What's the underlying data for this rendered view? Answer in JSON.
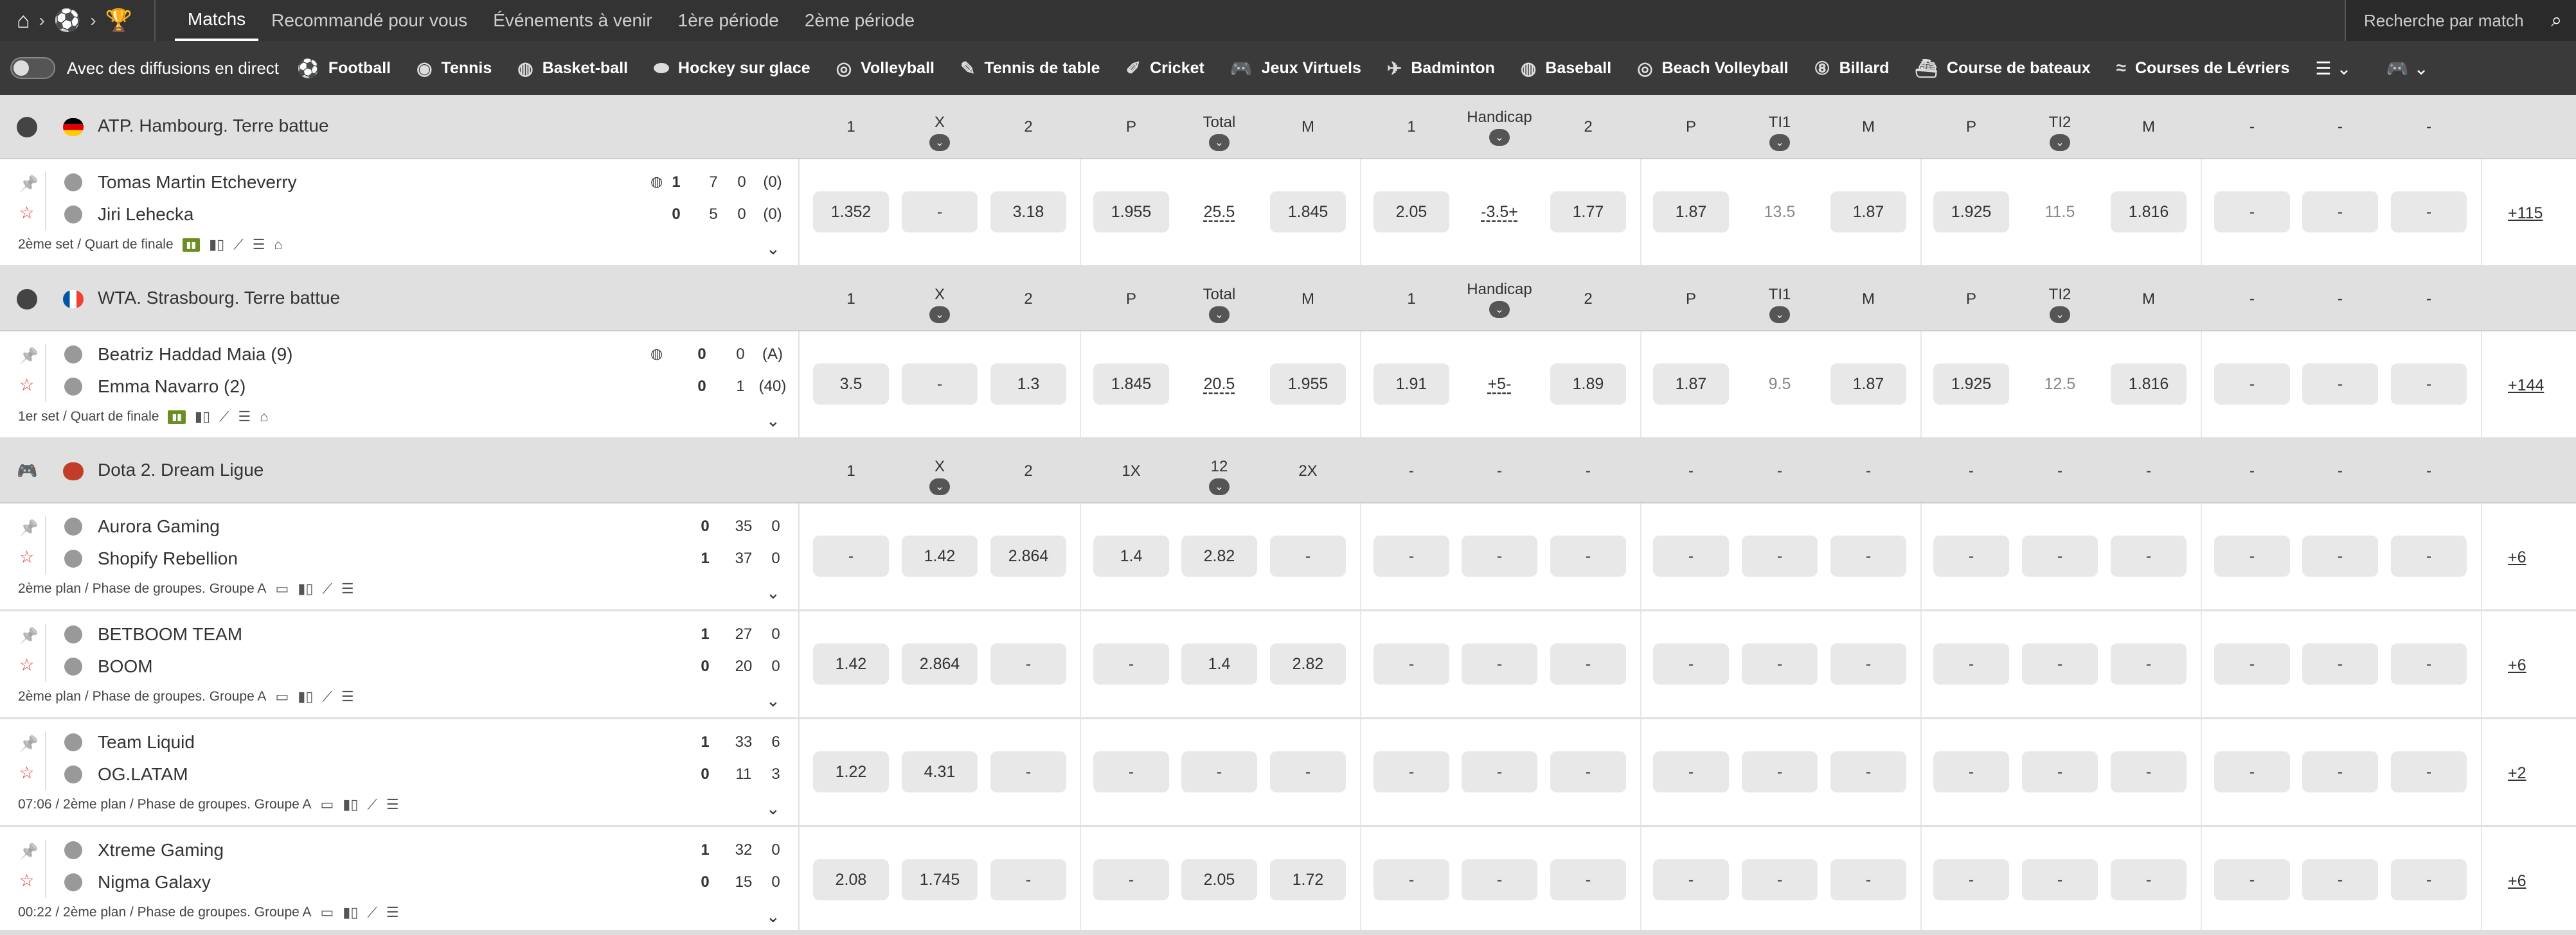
{
  "nav": {
    "home_icon": "home-icon",
    "tabs": [
      {
        "label": "Matchs",
        "active": true
      },
      {
        "label": "Recommandé pour vous"
      },
      {
        "label": "Événements à venir"
      },
      {
        "label": "1ère période"
      },
      {
        "label": "2ème période"
      }
    ],
    "search_placeholder": "Recherche par match"
  },
  "sports_bar": {
    "live_label": "Avec des diffusions en direct",
    "sports": [
      "Football",
      "Tennis",
      "Basket-ball",
      "Hockey sur glace",
      "Volleyball",
      "Tennis de table",
      "Cricket",
      "Jeux Virtuels",
      "Badminton",
      "Baseball",
      "Beach Volleyball",
      "Billard",
      "Course de bateaux",
      "Courses de Lévriers"
    ]
  },
  "leagues": [
    {
      "name": "ATP. Hambourg. Terre battue",
      "flag": "germany",
      "sport_icon": "tennis-ball-icon",
      "headers": [
        "1",
        "X",
        "2",
        "P",
        "Total",
        "M",
        "1",
        "Handicap",
        "2",
        "P",
        "TI1",
        "M",
        "P",
        "TI2",
        "M",
        "-",
        "-",
        "-"
      ],
      "events": [
        {
          "team1": "Tomas Martin Etcheverry",
          "team2": "Jiri Lehecka",
          "s1": [
            "1",
            "7",
            "0",
            "(0)"
          ],
          "s2": [
            "0",
            "5",
            "0",
            "(0)"
          ],
          "info": "2ème set / Quart de finale",
          "odds": [
            "1.352",
            "-",
            "3.18",
            "1.955",
            "25.5",
            "1.845",
            "2.05",
            "-3.5+",
            "1.77",
            "1.87",
            "13.5",
            "1.87",
            "1.925",
            "11.5",
            "1.816",
            "-",
            "-",
            "-"
          ],
          "more": "+115"
        }
      ]
    },
    {
      "name": "WTA. Strasbourg. Terre battue",
      "flag": "france",
      "sport_icon": "tennis-ball-icon",
      "headers": [
        "1",
        "X",
        "2",
        "P",
        "Total",
        "M",
        "1",
        "Handicap",
        "2",
        "P",
        "TI1",
        "M",
        "P",
        "TI2",
        "M",
        "-",
        "-",
        "-"
      ],
      "events": [
        {
          "team1": "Beatriz Haddad Maia (9)",
          "team2": "Emma Navarro (2)",
          "s1": [
            "0",
            "0",
            "(A)"
          ],
          "s2": [
            "0",
            "1",
            "(40)"
          ],
          "info": "1er set / Quart de finale",
          "odds": [
            "3.5",
            "-",
            "1.3",
            "1.845",
            "20.5",
            "1.955",
            "1.91",
            "+5-",
            "1.89",
            "1.87",
            "9.5",
            "1.87",
            "1.925",
            "12.5",
            "1.816",
            "-",
            "-",
            "-"
          ],
          "more": "+144"
        }
      ]
    },
    {
      "name": "Dota 2. Dream Ligue",
      "flag": "dota",
      "sport_icon": "gamepad-icon",
      "headers": [
        "1",
        "X",
        "2",
        "1X",
        "12",
        "2X",
        "-",
        "-",
        "-",
        "-",
        "-",
        "-",
        "-",
        "-",
        "-",
        "-",
        "-",
        "-"
      ],
      "events": [
        {
          "team1": "Aurora Gaming",
          "team2": "Shopify Rebellion",
          "s1": [
            "0",
            "35",
            "0"
          ],
          "s2": [
            "1",
            "37",
            "0"
          ],
          "info": "2ème plan / Phase de groupes. Groupe A",
          "odds": [
            "-",
            "1.42",
            "2.864",
            "1.4",
            "2.82",
            "-",
            "-",
            "-",
            "-",
            "-",
            "-",
            "-",
            "-",
            "-",
            "-",
            "-",
            "-",
            "-"
          ],
          "more": "+6"
        },
        {
          "team1": "BETBOOM TEAM",
          "team2": "BOOM",
          "s1": [
            "1",
            "27",
            "0"
          ],
          "s2": [
            "0",
            "20",
            "0"
          ],
          "info": "2ème plan / Phase de groupes. Groupe A",
          "odds": [
            "1.42",
            "2.864",
            "-",
            "-",
            "1.4",
            "2.82",
            "-",
            "-",
            "-",
            "-",
            "-",
            "-",
            "-",
            "-",
            "-",
            "-",
            "-",
            "-"
          ],
          "more": "+6"
        },
        {
          "team1": "Team Liquid",
          "team2": "OG.LATAM",
          "s1": [
            "1",
            "33",
            "6"
          ],
          "s2": [
            "0",
            "11",
            "3"
          ],
          "info": "07:06 / 2ème plan / Phase de groupes. Groupe A",
          "odds": [
            "1.22",
            "4.31",
            "-",
            "-",
            "-",
            "-",
            "-",
            "-",
            "-",
            "-",
            "-",
            "-",
            "-",
            "-",
            "-",
            "-",
            "-",
            "-"
          ],
          "more": "+2"
        },
        {
          "team1": "Xtreme Gaming",
          "team2": "Nigma Galaxy",
          "s1": [
            "1",
            "32",
            "0"
          ],
          "s2": [
            "0",
            "15",
            "0"
          ],
          "info": "00:22 / 2ème plan / Phase de groupes. Groupe A",
          "odds": [
            "2.08",
            "1.745",
            "-",
            "-",
            "2.05",
            "1.72",
            "-",
            "-",
            "-",
            "-",
            "-",
            "-",
            "-",
            "-",
            "-",
            "-",
            "-",
            "-"
          ],
          "more": "+6"
        }
      ]
    }
  ]
}
